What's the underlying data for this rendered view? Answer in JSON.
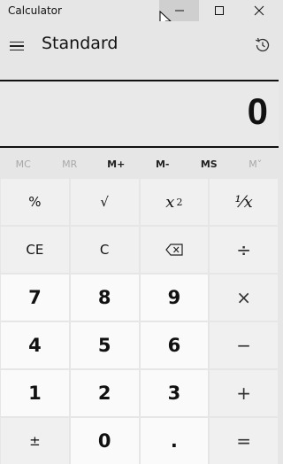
{
  "window": {
    "title": "Calculator",
    "minimize_glyph": "—",
    "maximize_glyph": "☐",
    "close_glyph": "✕"
  },
  "header": {
    "mode_title": "Standard",
    "menu_icon": "hamburger-icon",
    "history_icon": "history-icon"
  },
  "display": {
    "value": "0"
  },
  "memory": {
    "buttons": [
      {
        "label": "MC",
        "enabled": false
      },
      {
        "label": "MR",
        "enabled": false
      },
      {
        "label": "M+",
        "enabled": true
      },
      {
        "label": "M-",
        "enabled": true
      },
      {
        "label": "MS",
        "enabled": true
      },
      {
        "label": "M˅",
        "enabled": false
      }
    ]
  },
  "keypad": {
    "percent": "%",
    "sqrt": "√",
    "square_base": "x",
    "square_exp": "2",
    "reciprocal": "¹⁄x",
    "clear_entry": "CE",
    "clear": "C",
    "backspace_icon": "backspace-icon",
    "divide": "÷",
    "seven": "7",
    "eight": "8",
    "nine": "9",
    "multiply": "×",
    "four": "4",
    "five": "5",
    "six": "6",
    "minus": "−",
    "one": "1",
    "two": "2",
    "three": "3",
    "plus": "+",
    "negate": "±",
    "zero": "0",
    "decimal": ".",
    "equals": "="
  },
  "colors": {
    "background": "#e6e6e6",
    "number_key": "#fafafa",
    "function_key": "#f0f0f0",
    "disabled_text": "#a8a8a8",
    "minimize_hover": "#cfcfcf"
  }
}
